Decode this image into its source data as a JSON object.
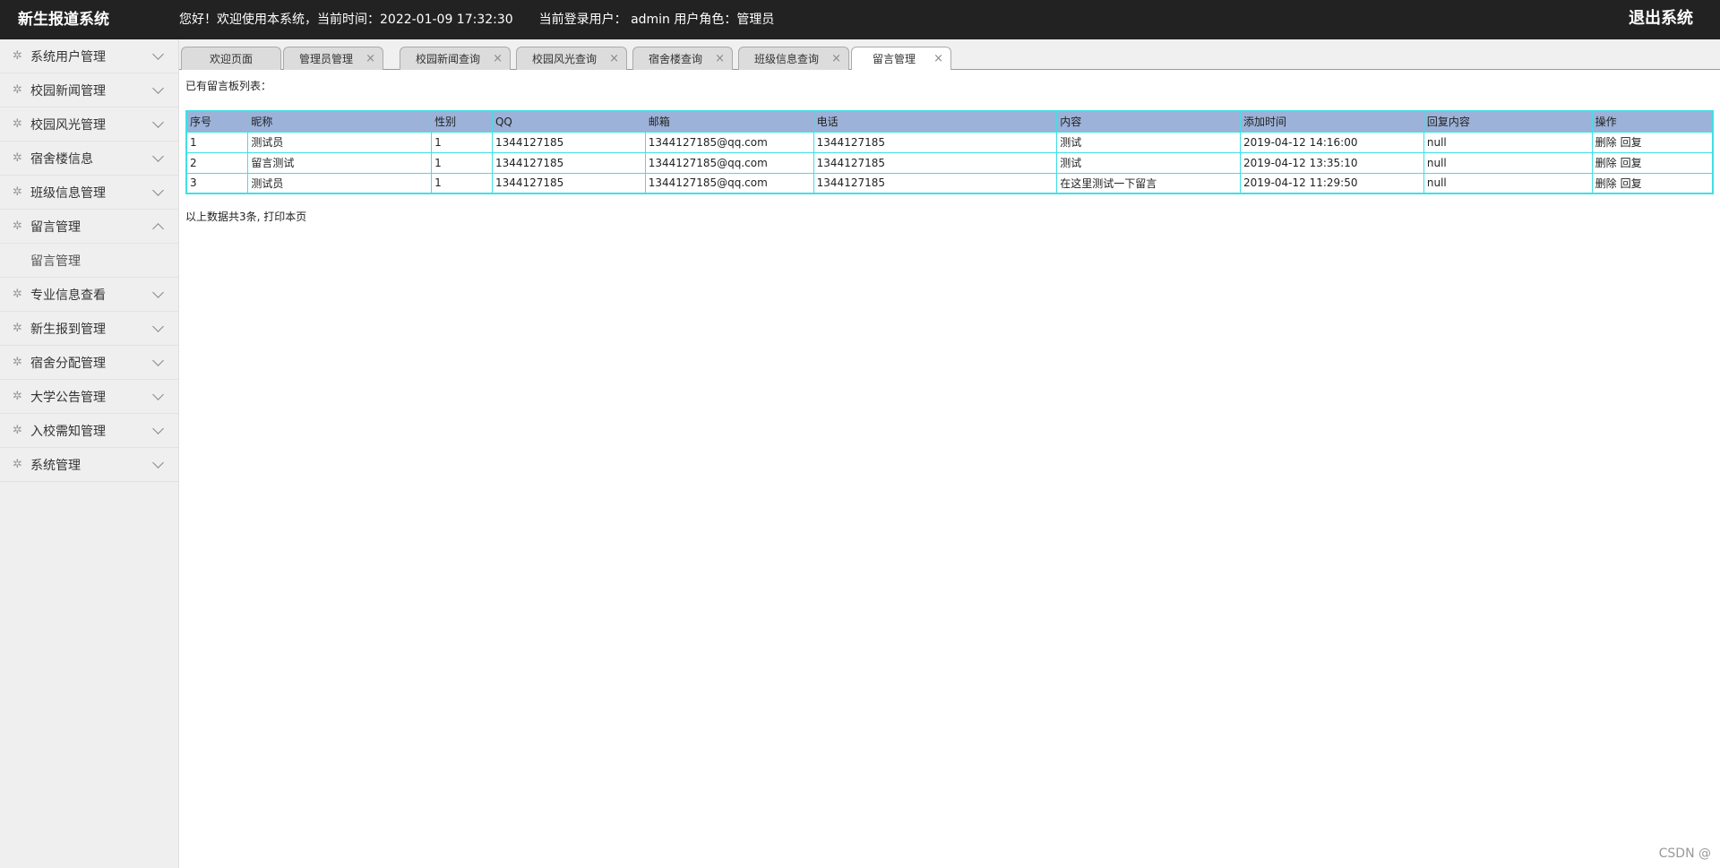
{
  "header": {
    "app_title": "新生报道系统",
    "greeting": "您好！欢迎使用本系统，当前时间：",
    "datetime": "2022-01-09 17:32:30",
    "current_user_label": "当前登录用户：",
    "current_user": "admin",
    "role_label": "用户角色：",
    "role": "管理员",
    "logout_label": "退出系统"
  },
  "sidebar": {
    "items": [
      {
        "label": "系统用户管理"
      },
      {
        "label": "校园新闻管理"
      },
      {
        "label": "校园风光管理"
      },
      {
        "label": "宿舍楼信息"
      },
      {
        "label": "班级信息管理"
      },
      {
        "label": "留言管理"
      },
      {
        "label": "专业信息查看"
      },
      {
        "label": "新生报到管理"
      },
      {
        "label": "宿舍分配管理"
      },
      {
        "label": "大学公告管理"
      },
      {
        "label": "入校需知管理"
      },
      {
        "label": "系统管理"
      }
    ],
    "expanded_sub": "留言管理"
  },
  "tabs": [
    {
      "label": "欢迎页面"
    },
    {
      "label": "管理员管理"
    },
    {
      "label": "校园新闻查询"
    },
    {
      "label": "校园风光查询"
    },
    {
      "label": "宿舍楼查询"
    },
    {
      "label": "班级信息查询"
    },
    {
      "label": "留言管理"
    }
  ],
  "tab_close_glyph": "×",
  "content": {
    "list_title": "已有留言板列表：",
    "columns": [
      "序号",
      "昵称",
      "性别",
      "QQ",
      "邮箱",
      "电话",
      "内容",
      "添加时间",
      "回复内容",
      "操作"
    ],
    "rows": [
      {
        "id": "1",
        "nickname": "测试员",
        "gender": "1",
        "qq": "1344127185",
        "email": "1344127185@qq.com",
        "phone": "1344127185",
        "content": "测试",
        "time": "2019-04-12 14:16:00",
        "reply": "null"
      },
      {
        "id": "2",
        "nickname": "留言测试",
        "gender": "1",
        "qq": "1344127185",
        "email": "1344127185@qq.com",
        "phone": "1344127185",
        "content": "测试",
        "time": "2019-04-12 13:35:10",
        "reply": "null"
      },
      {
        "id": "3",
        "nickname": "测试员",
        "gender": "1",
        "qq": "1344127185",
        "email": "1344127185@qq.com",
        "phone": "1344127185",
        "content": "在这里测试一下留言",
        "time": "2019-04-12 11:29:50",
        "reply": "null"
      }
    ],
    "op_delete": "删除",
    "op_reply": "回复",
    "summary_text": "以上数据共3条,",
    "print_label": "打印本页"
  },
  "watermark": "CSDN @",
  "colors": {
    "header_bg": "#222222",
    "table_head_bg": "#9db2d8",
    "table_border": "#3fe0e6"
  }
}
